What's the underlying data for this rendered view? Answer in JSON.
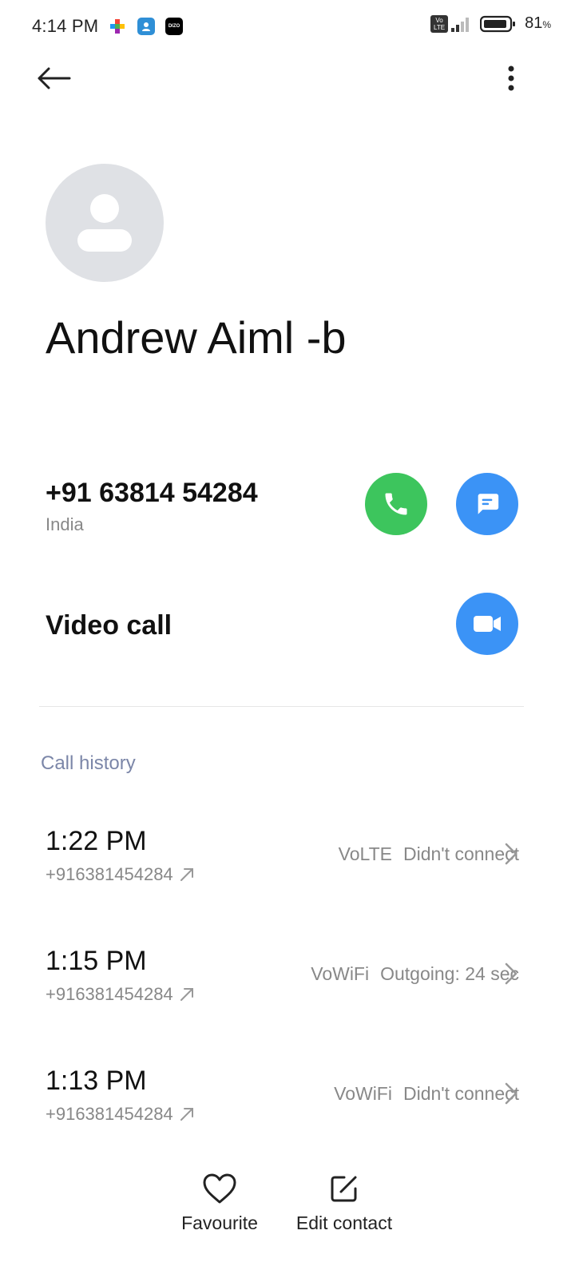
{
  "status_bar": {
    "time": "4:14 PM",
    "battery_percent": "81",
    "battery_unit": "%",
    "volte_badge_line1": "Vo",
    "volte_badge_line2": "LTE",
    "app_icons": [
      "puzzle-app-icon",
      "contacts-app-icon",
      "dizo-app-icon"
    ],
    "dizo_label": "DIZO"
  },
  "contact": {
    "name": "Andrew Aiml -b",
    "phone": "+91 63814 54284",
    "country": "India",
    "video_call_label": "Video call"
  },
  "call_history": {
    "title": "Call history",
    "rows": [
      {
        "time": "1:22 PM",
        "number": "+916381454284",
        "network": "VoLTE",
        "status": "Didn't connect"
      },
      {
        "time": "1:15 PM",
        "number": "+916381454284",
        "network": "VoWiFi",
        "status": "Outgoing: 24 sec"
      },
      {
        "time": "1:13 PM",
        "number": "+916381454284",
        "network": "VoWiFi",
        "status": "Didn't connect"
      }
    ]
  },
  "bottom_actions": {
    "favourite": "Favourite",
    "edit_contact": "Edit contact"
  },
  "colors": {
    "call_green": "#3dc55d",
    "action_blue": "#3b93f6",
    "section_title": "#7b86a8",
    "avatar_bg": "#dfe1e5"
  }
}
